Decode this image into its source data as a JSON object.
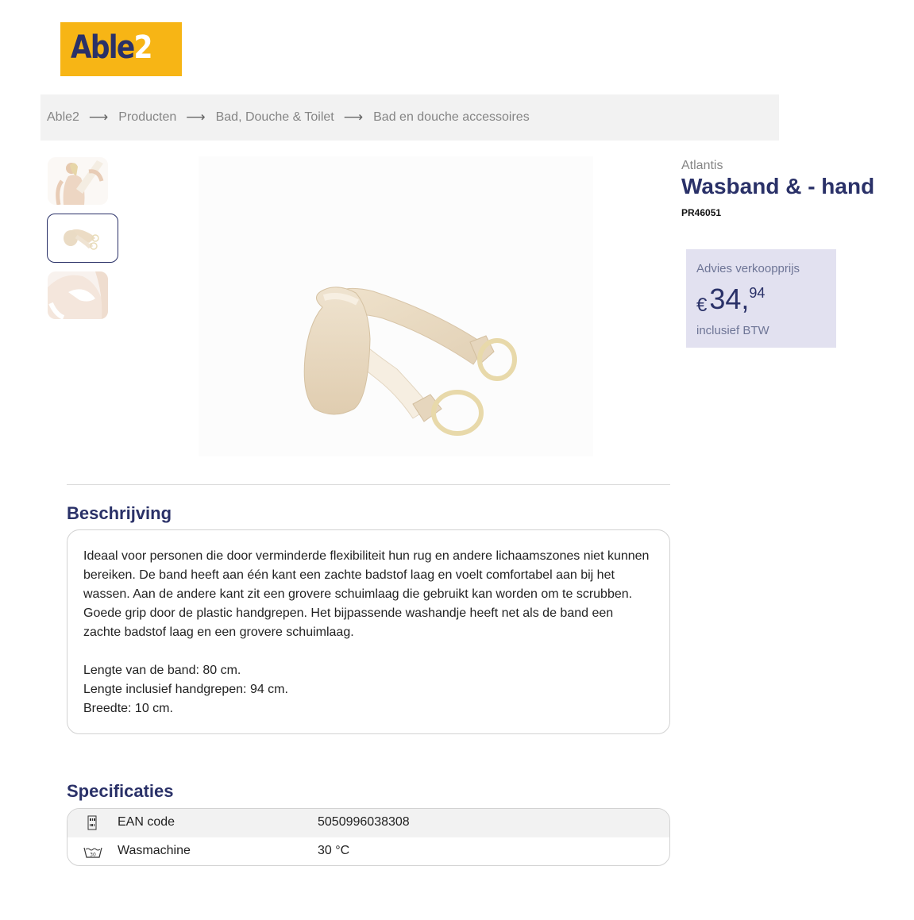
{
  "logo": {
    "text_main": "Able",
    "text_accent": "2"
  },
  "breadcrumb": [
    "Able2",
    "Producten",
    "Bad, Douche & Toilet",
    "Bad en douche accessoires"
  ],
  "breadcrumb_separator": "⟶",
  "product": {
    "brand": "Atlantis",
    "title": "Wasband & - hand",
    "sku": "PR46051"
  },
  "price": {
    "label": "Advies verkoopprijs",
    "currency": "€",
    "main": "34,",
    "cents": "94",
    "note": "inclusief BTW"
  },
  "description": {
    "heading": "Beschrijving",
    "paragraph": "Ideaal voor personen die door verminderde flexibiliteit hun rug en andere lichaamszones niet kunnen bereiken. De band heeft aan één kant een zachte badstof laag en voelt comfortabel aan bij het wassen. Aan de andere kant zit een grovere schuimlaag die gebruikt kan worden om te scrubben. Goede grip door de plastic handgrepen. Het bijpassende washandje heeft net als de band een zachte badstof laag en een grovere schuimlaag.",
    "lines": [
      "Lengte van de band: 80 cm.",
      "Lengte inclusief handgrepen: 94 cm.",
      "Breedte: 10 cm."
    ]
  },
  "specs": {
    "heading": "Specificaties",
    "rows": [
      {
        "icon": "barcode-icon",
        "name": "EAN code",
        "value": "5050996038308"
      },
      {
        "icon": "wash-30-icon",
        "name": "Wasmachine",
        "value": "30 °C"
      }
    ]
  },
  "colors": {
    "brand_navy": "#2a3168",
    "brand_yellow": "#f7b515",
    "price_bg": "#e2e1f0",
    "breadcrumb_bg": "#f2f2f2"
  }
}
